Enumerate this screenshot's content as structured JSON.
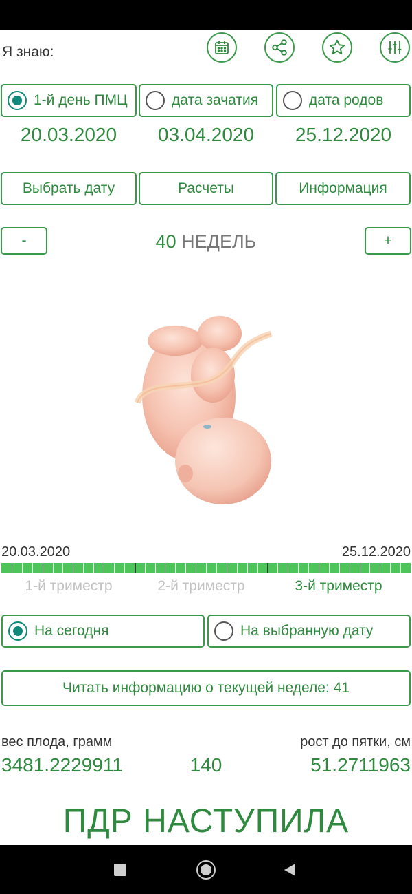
{
  "header": {
    "know_label": "Я знаю:"
  },
  "toolbar": {
    "icons": [
      "calendar-icon",
      "share-icon",
      "star-icon",
      "sliders-icon"
    ]
  },
  "modes": [
    {
      "label": "1-й день ПМЦ",
      "checked": true,
      "date": "20.03.2020"
    },
    {
      "label": "дата зачатия",
      "checked": false,
      "date": "03.04.2020"
    },
    {
      "label": "дата родов",
      "checked": false,
      "date": "25.12.2020"
    }
  ],
  "actions": {
    "choose_date": "Выбрать дату",
    "calculations": "Расчеты",
    "information": "Информация"
  },
  "week": {
    "minus": "-",
    "plus": "+",
    "number": "40",
    "unit": "НЕДЕЛЬ"
  },
  "timeline": {
    "start": "20.03.2020",
    "end": "25.12.2020",
    "progress": 1.0,
    "trimesters": [
      "1-й триместр",
      "2-й триместр",
      "3-й триместр"
    ],
    "active_trimester": 3
  },
  "date_mode": {
    "today": "На сегодня",
    "selected": "На выбранную дату",
    "today_checked": true
  },
  "read_info": "Читать информацию о текущей неделе: 41",
  "stats": {
    "weight_label": "вес плода, грамм",
    "height_label": "рост до пятки, см",
    "weight": "3481.2229911",
    "middle": "140",
    "height": "51.2711963"
  },
  "status": "ПДР НАСТУПИЛА",
  "colors": {
    "accent": "#2f8a3f",
    "progress": "#4ec55a",
    "radio": "#0f8a7a"
  }
}
